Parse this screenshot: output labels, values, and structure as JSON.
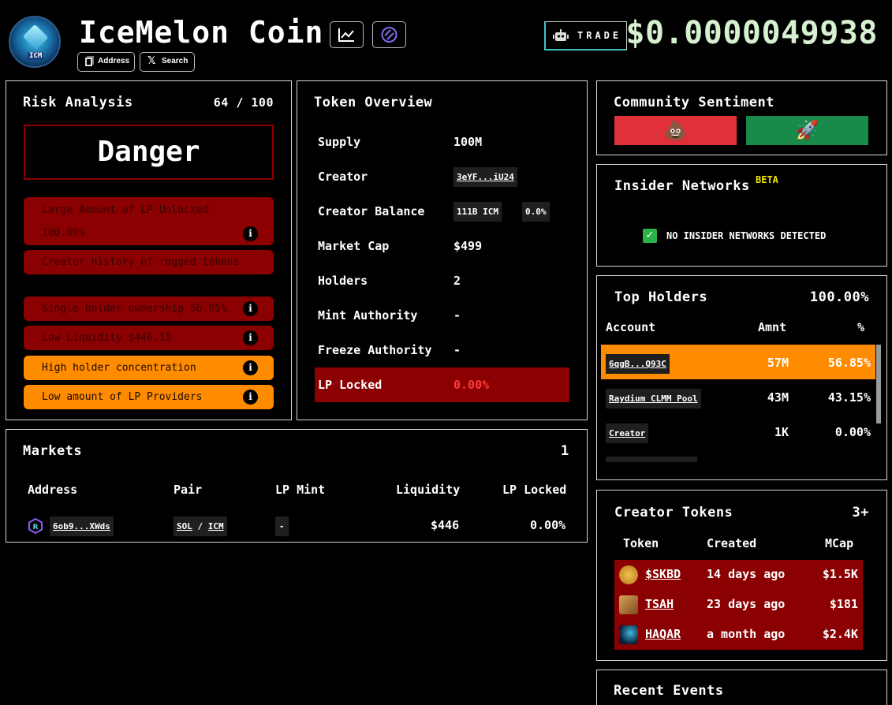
{
  "header": {
    "coin_name": "IceMelon Coin",
    "address_button": "Address",
    "search_button": "Search",
    "trade_button": "TRADE",
    "price": "$0.0000049938",
    "logo_text": "ICM"
  },
  "risk": {
    "title": "Risk Analysis",
    "score": "64 / 100",
    "level": "Danger",
    "items": [
      {
        "line1": "Large Amount of LP Unlocked",
        "line2": "100.00%",
        "severity": "danger"
      },
      {
        "line1": "Creator history of rugged tokens",
        "severity": "danger"
      },
      {
        "line1": "Single holder ownership 56.85%",
        "severity": "danger"
      },
      {
        "line1": "Low Liquidity $446.15",
        "severity": "danger"
      },
      {
        "line1": "High holder concentration",
        "severity": "warning"
      },
      {
        "line1": "Low amount of LP Providers",
        "severity": "warning"
      }
    ]
  },
  "overview": {
    "title": "Token Overview",
    "supply_label": "Supply",
    "supply": "100M",
    "creator_label": "Creator",
    "creator": "3eYF...iU24",
    "creator_balance_label": "Creator Balance",
    "creator_balance": "111B ICM",
    "creator_balance_pct": "0.0%",
    "market_cap_label": "Market Cap",
    "market_cap": "$499",
    "holders_label": "Holders",
    "holders": "2",
    "mint_label": "Mint Authority",
    "mint": "-",
    "freeze_label": "Freeze Authority",
    "freeze": "-",
    "lp_locked_label": "LP Locked",
    "lp_locked": "0.00%"
  },
  "sentiment": {
    "title": "Community Sentiment",
    "bad_emoji": "💩",
    "good_emoji": "🚀",
    "bad_color": "#e0303a",
    "good_color": "#1a8a4a"
  },
  "insider": {
    "title": "Insider Networks",
    "badge": "BETA",
    "status": "NO INSIDER NETWORKS DETECTED"
  },
  "holders": {
    "title": "Top Holders",
    "total": "100.00%",
    "col_account": "Account",
    "col_amount": "Amnt",
    "col_pct": "%",
    "rows": [
      {
        "account": "6qgB...Q93C",
        "amount": "57M",
        "pct": "56.85%"
      },
      {
        "account": "Raydium CLMM Pool",
        "amount": "43M",
        "pct": "43.15%"
      },
      {
        "account": "Creator",
        "amount": "1K",
        "pct": "0.00%"
      }
    ]
  },
  "markets": {
    "title": "Markets",
    "count": "1",
    "col_address": "Address",
    "col_pair": "Pair",
    "col_lp_mint": "LP Mint",
    "col_liquidity": "Liquidity",
    "col_lp_locked": "LP Locked",
    "row": {
      "address": "6ob9...XWds",
      "pair_base": "SOL",
      "pair_sep": "/",
      "pair_quote": "ICM",
      "lp_mint": "-",
      "liquidity": "$446",
      "lp_locked": "0.00%"
    }
  },
  "creator_tokens": {
    "title": "Creator Tokens",
    "count": "3+",
    "col_token": "Token",
    "col_created": "Created",
    "col_mcap": "MCap",
    "rows": [
      {
        "token": "$SKBD",
        "created": "14 days ago",
        "mcap": "$1.5K"
      },
      {
        "token": "TSAH",
        "created": "23 days ago",
        "mcap": "$181"
      },
      {
        "token": "HAQAR",
        "created": "a month ago",
        "mcap": "$2.4K"
      }
    ]
  },
  "recent_events": {
    "title": "Recent Events"
  },
  "colors": {
    "danger": "#8b0000",
    "warning": "#ff8c00",
    "holder_highlight": "#ff8c00"
  }
}
